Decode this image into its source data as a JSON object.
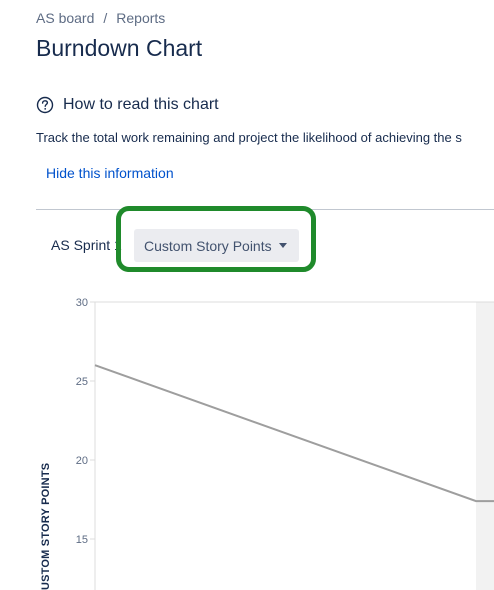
{
  "breadcrumb": {
    "board": "AS board",
    "separator": "/",
    "current": "Reports"
  },
  "page": {
    "title": "Burndown Chart"
  },
  "info": {
    "heading": "How to read this chart",
    "text": "Track the total work remaining and project the likelihood of achieving the s",
    "hide_link": "Hide this information"
  },
  "filters": {
    "sprint_label": "AS Sprint",
    "sprint_trail": "1",
    "estimation_button": "Custom Story Points"
  },
  "colors": {
    "highlight": "#1f8a2b",
    "link": "#0052cc",
    "line": "#9e9e9e"
  },
  "chart_data": {
    "type": "line",
    "ylabel": "USTOM STORY POINTS",
    "ylim": [
      12,
      30
    ],
    "y_ticks": [
      15,
      20,
      25,
      30
    ],
    "series": [
      {
        "points": [
          [
            0,
            26
          ],
          [
            1,
            17.4
          ],
          [
            1.2,
            17.4
          ]
        ]
      }
    ],
    "grid": false
  }
}
